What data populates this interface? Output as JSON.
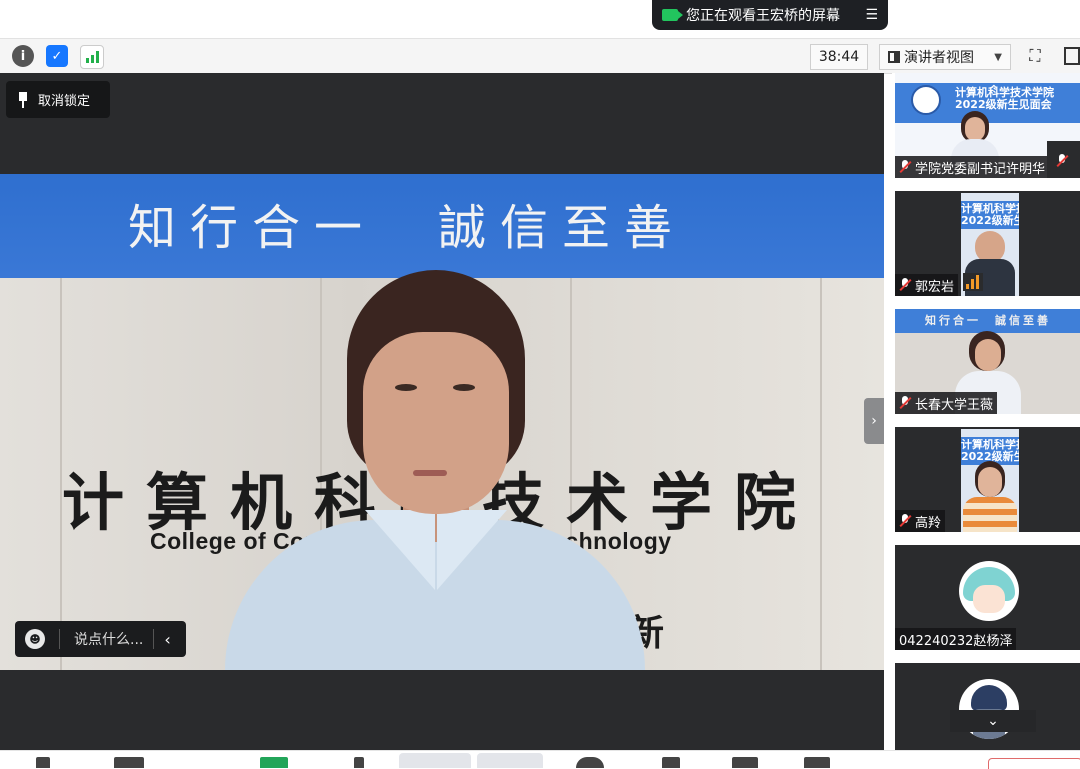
{
  "share_banner": {
    "text": "您正在观看王宏桥的屏幕",
    "menu_icon": "list-icon"
  },
  "toolbar": {
    "info_icon": "i",
    "shield_icon": "shield-icon",
    "signal_icon": "signal-bars-icon",
    "timer": "38:44",
    "view_mode": "演讲者视图",
    "fullscreen_icon": "⛶"
  },
  "main": {
    "unlock_label": "取消锁定",
    "banner_slogan": "知行合一　誠信至善",
    "college_cn": "计算机科学技术学院",
    "college_en": "College of Computer Science and Technology",
    "plaque_char": "新",
    "chat_placeholder": "说点什么...",
    "collapse_icon": "›"
  },
  "gallery": {
    "tiles": [
      {
        "name": "学院党委副书记许明华",
        "muted": true,
        "banner": "计算机科学技术学院\n2022级新生见面会"
      },
      {
        "name": "郭宏岩",
        "muted": true,
        "speaking": true,
        "banner": "计算机科学技\n2022级新生见"
      },
      {
        "name": "长春大学王薇",
        "muted": true,
        "banner": "知行合一　誠信至善"
      },
      {
        "name": "高羚",
        "muted": true,
        "banner": "计算机科学技\n2022级新生见"
      },
      {
        "name": "042240232赵杨泽",
        "muted": false,
        "avatar": true
      },
      {
        "name": "",
        "muted": false,
        "avatar": true
      }
    ]
  },
  "colors": {
    "accent_green": "#22c55e",
    "shield_blue": "#1677ff",
    "dark_bg": "#2a2b2d",
    "speaking_orange": "#f39a28",
    "mute_red": "#e53935"
  }
}
